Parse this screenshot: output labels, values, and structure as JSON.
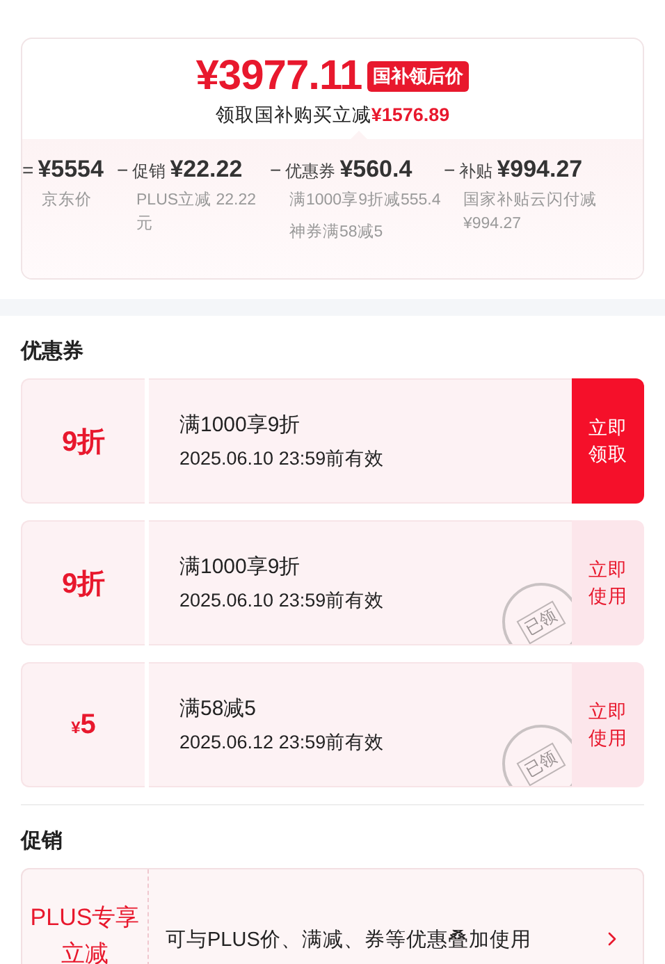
{
  "price_card": {
    "price": "¥3977.11",
    "badge": "国补领后价",
    "subline": "领取国补购买立减",
    "subline_amount": "¥1576.89",
    "breakdown": [
      {
        "op": "=",
        "amount": "¥5554",
        "notes": [
          "京东价"
        ]
      },
      {
        "op": "−",
        "label": "促销",
        "amount": "¥22.22",
        "notes": [
          "PLUS立减 22.22元"
        ]
      },
      {
        "op": "−",
        "label": "优惠券",
        "amount": "¥560.4",
        "notes": [
          "满1000享9折减555.4",
          "神券满58减5"
        ]
      },
      {
        "op": "−",
        "label": "补贴",
        "amount": "¥994.27",
        "notes": [
          "国家补贴云闪付减¥994.27"
        ]
      }
    ]
  },
  "coupons_section": {
    "title": "优惠券",
    "coupons": [
      {
        "value": "9折",
        "condition": "满1000享9折",
        "validity": "2025.06.10 23:59前有效",
        "claimed": false,
        "button": "立即领取"
      },
      {
        "value": "9折",
        "condition": "满1000享9折",
        "validity": "2025.06.10 23:59前有效",
        "claimed": true,
        "stamp": "已领",
        "button": "立即使用"
      },
      {
        "currency": "¥",
        "value": "5",
        "condition": "满58减5",
        "validity": "2025.06.12 23:59前有效",
        "claimed": true,
        "stamp": "已领",
        "button": "立即使用"
      }
    ]
  },
  "promo_section": {
    "title": "促销",
    "promos": [
      {
        "tag": "PLUS专享立减",
        "text": "可与PLUS价、满减、券等优惠叠加使用"
      }
    ]
  }
}
